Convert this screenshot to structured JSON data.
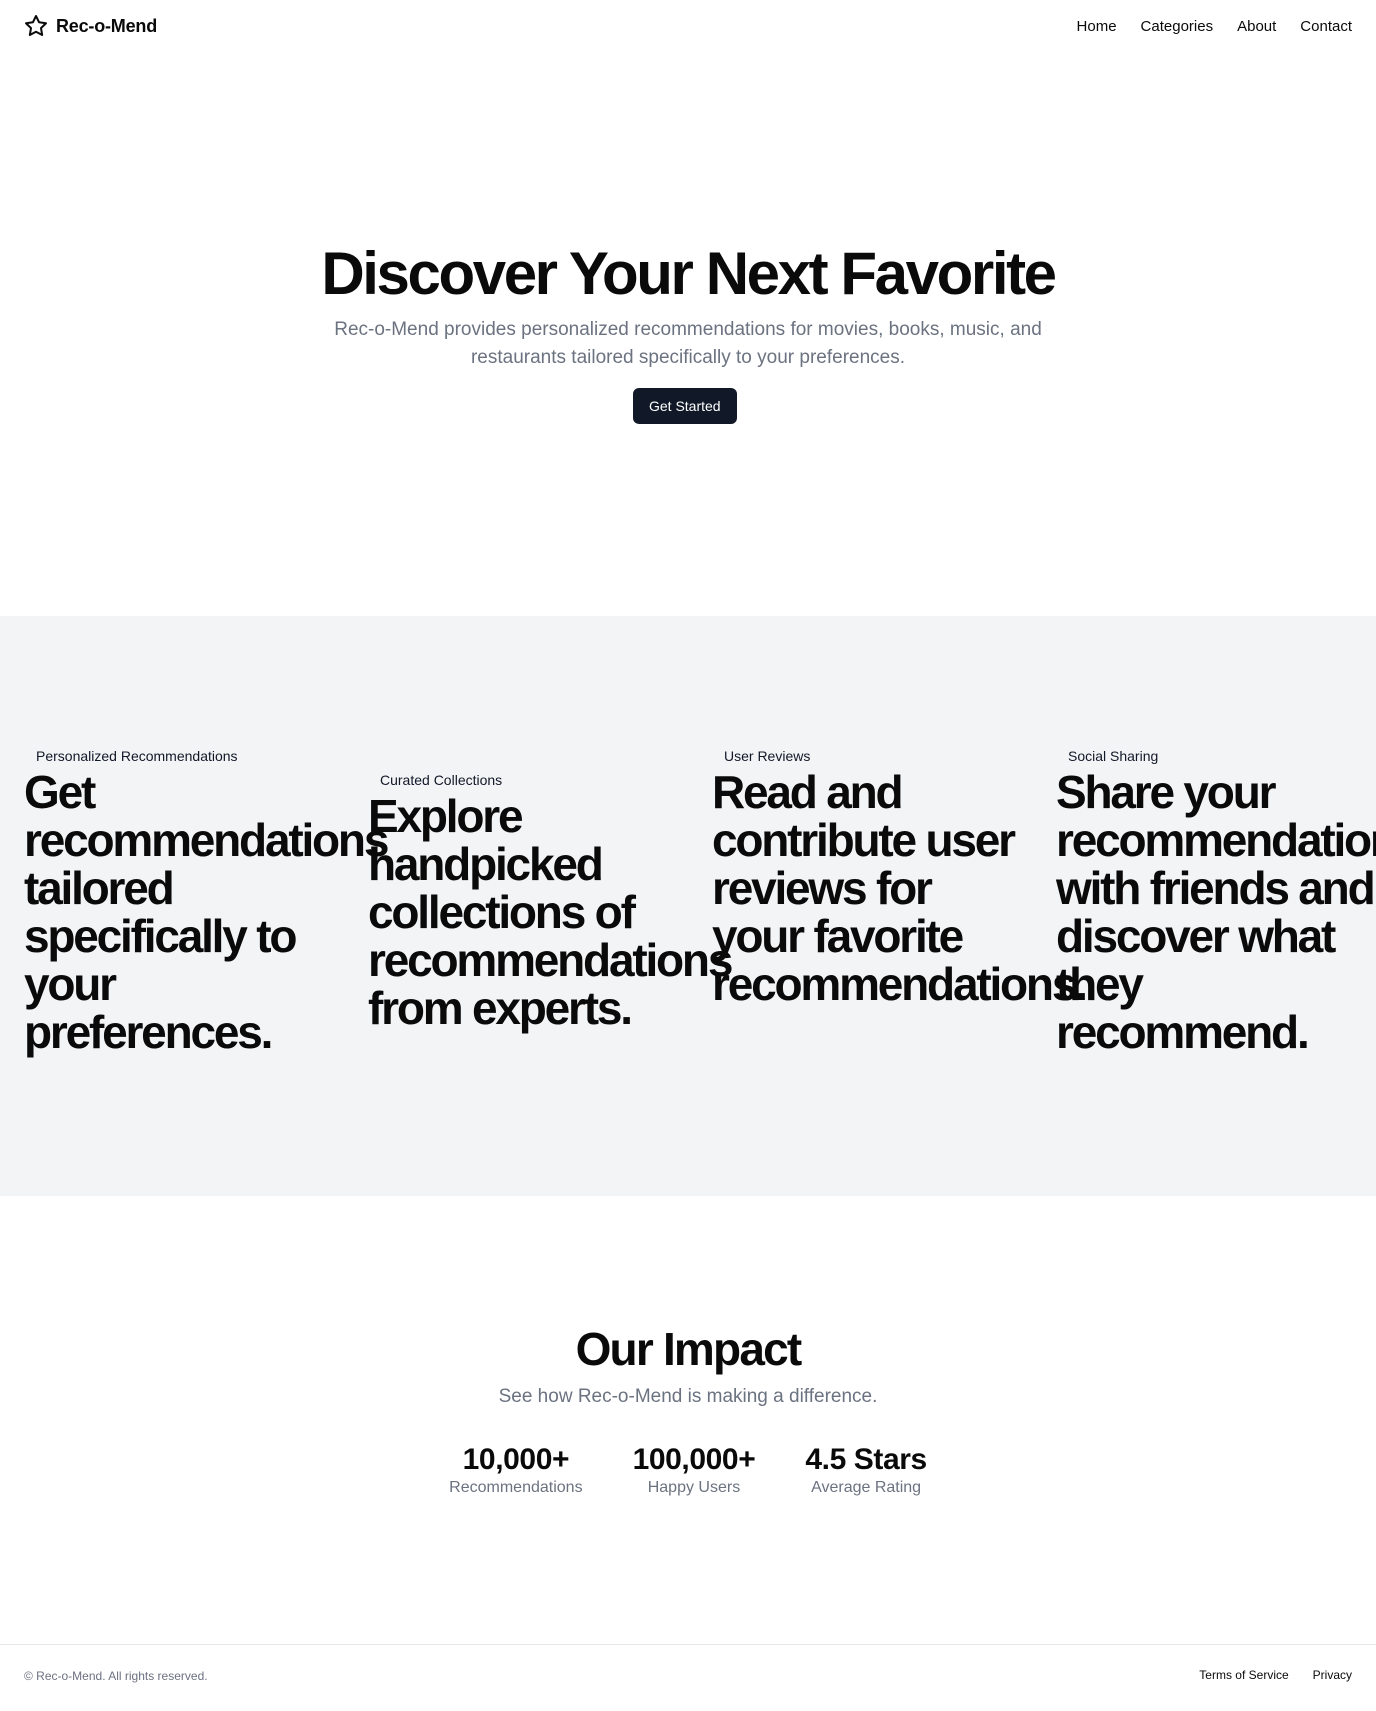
{
  "header": {
    "brand_name": "Rec-o-Mend",
    "brand_icon": "star-icon",
    "nav": [
      {
        "label": "Home"
      },
      {
        "label": "Categories"
      },
      {
        "label": "About"
      },
      {
        "label": "Contact"
      }
    ]
  },
  "hero": {
    "title": "Discover Your Next Favorite",
    "subtitle": "Rec-o-Mend provides personalized recommendations for movies, books, music, and restaurants tailored specifically to your preferences.",
    "cta_label": "Get Started"
  },
  "features": [
    {
      "title": "Personalized Recommendations",
      "description": "Get recommendations tailored specifically to your preferences."
    },
    {
      "title": "Curated Collections",
      "description": "Explore handpicked collections of recommendations from experts."
    },
    {
      "title": "User Reviews",
      "description": "Read and contribute user reviews for your favorite recommendations."
    },
    {
      "title": "Social Sharing",
      "description": "Share your recommendations with friends and discover what they recommend."
    }
  ],
  "impact": {
    "title": "Our Impact",
    "subtitle": "See how Rec-o-Mend is making a difference.",
    "stats": [
      {
        "value": "10,000+",
        "label": "Recommendations"
      },
      {
        "value": "100,000+",
        "label": "Happy Users"
      },
      {
        "value": "4.5 Stars",
        "label": "Average Rating"
      }
    ]
  },
  "footer": {
    "copyright": "© Rec-o-Mend. All rights reserved.",
    "links": [
      {
        "label": "Terms of Service"
      },
      {
        "label": "Privacy"
      }
    ]
  },
  "colors": {
    "primary_button": "#111827",
    "muted_text": "#6b7280",
    "section_bg": "#f3f4f6"
  }
}
